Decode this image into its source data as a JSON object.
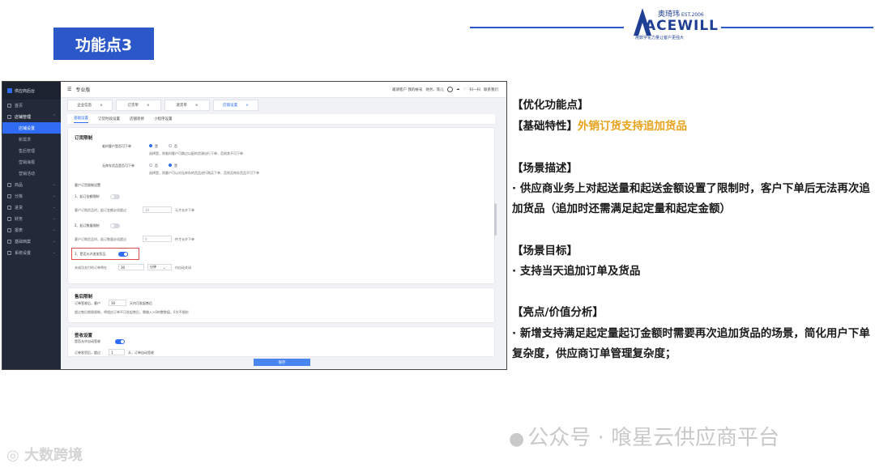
{
  "slide": {
    "title": "功能点3",
    "logo": {
      "cn": "奥琦玮",
      "est": "EST.2006",
      "word": "ACEWILL",
      "tagline": "用数字化力量让客户更强大"
    }
  },
  "app": {
    "brand": "供应商后台",
    "edition": "专业版",
    "topbar_right": [
      "邀请客户 我的帐号",
      "财务、陈儿",
      "扫一扫",
      "联系我们"
    ],
    "sidebar": [
      {
        "label": "首页",
        "icon": "home-icon"
      },
      {
        "label": "店铺管理",
        "icon": "store-icon",
        "expanded": true,
        "children": [
          "店铺设置",
          "新需求",
          "售后管理",
          "营销海报",
          "营销活动"
        ]
      },
      {
        "label": "商品",
        "icon": "goods-icon"
      },
      {
        "label": "分拣",
        "icon": "sort-icon"
      },
      {
        "label": "进货",
        "icon": "purchase-icon"
      },
      {
        "label": "财务",
        "icon": "finance-icon"
      },
      {
        "label": "报表",
        "icon": "report-icon"
      },
      {
        "label": "基础档案",
        "icon": "archive-icon"
      },
      {
        "label": "系统设置",
        "icon": "settings-icon"
      }
    ],
    "active_sidebar_child": "店铺设置",
    "tabs": [
      "企业信息",
      "订货单",
      "退货单",
      "店铺设置"
    ],
    "active_tab": "店铺设置",
    "subtabs": [
      "基础设置",
      "订货时段设置",
      "店铺装修",
      "小程序设置"
    ],
    "active_subtab": "基础设置",
    "order_limit": {
      "title": "订货限制",
      "temp_customer_label": "临时客户是否可下单",
      "temp_yes": "是",
      "temp_no": "否",
      "temp_hint": "选择是，则临时客户可跳过以配的货源自行下单，否则其不可下单",
      "no_stock_label": "无库存货品是否可下单",
      "no_stock_no": "否",
      "no_stock_yes": "是",
      "no_stock_hint": "选择是，则客户可以对无库存的货品进行购买下单，否则无库存货品不可下单",
      "customer_order_limit": "客户订货限制设置",
      "min_amount_label": "1、起订金额限制",
      "min_amount_desc": "客户订购货品时，起订金额必须超过",
      "min_amount_placeholder": "30",
      "min_amount_unit": "元才允许下单",
      "min_qty_label": "2、起订数量限制",
      "min_qty_desc": "客户订购货品时，起订数量必须超过",
      "min_qty_placeholder": "0",
      "min_qty_unit": "件才允许下单",
      "allow_add_label": "3、是否允许追加货品",
      "unpaid_label": "未成功支付的订单将在",
      "unpaid_value": "30",
      "unpaid_unit_select": "分钟",
      "unpaid_tail": "内自动关闭"
    },
    "after_sale": {
      "title": "售后限制",
      "line1_a": "订单签收后，客户",
      "line1_value": "30",
      "line1_b": "天内可发起售后",
      "hint": "超过售后期限限制，将相应订单不可发起售后，需输入>0的整数值，0为不限制"
    },
    "sign": {
      "title": "签收设置",
      "auto_label": "是否允许自动签收",
      "line_a": "订单发货后，超过",
      "line_value": "1",
      "line_b": "天，订单自动签收"
    },
    "save_label": "保存"
  },
  "right_text": {
    "heading": "【优化功能点】",
    "feature_prefix": "【基础特性】",
    "feature_highlight": "外销订货支持追加货品",
    "scene_title": "【场景描述】",
    "scene_body": "· 供应商业务上对起送量和起送金额设置了限制时，客户下单后无法再次追加货品（追加时还需满足起定量和起定金额）",
    "goal_title": "【场景目标】",
    "goal_body": "· 支持当天追加订单及货品",
    "value_title": "【亮点/价值分析】",
    "value_body": "· 新增支持满足起定量起订金额时需要再次追加货品的场景，简化用户下单复杂度，供应商订单管理复杂度；"
  },
  "watermark": {
    "wechat": "公众号 · 喰星云供应商平台",
    "corner": "大数跨境"
  },
  "colors": {
    "brand_blue": "#2b57c8",
    "highlight": "#e8a21a",
    "app_blue": "#2f6cf3",
    "sidebar": "#222a3a"
  }
}
